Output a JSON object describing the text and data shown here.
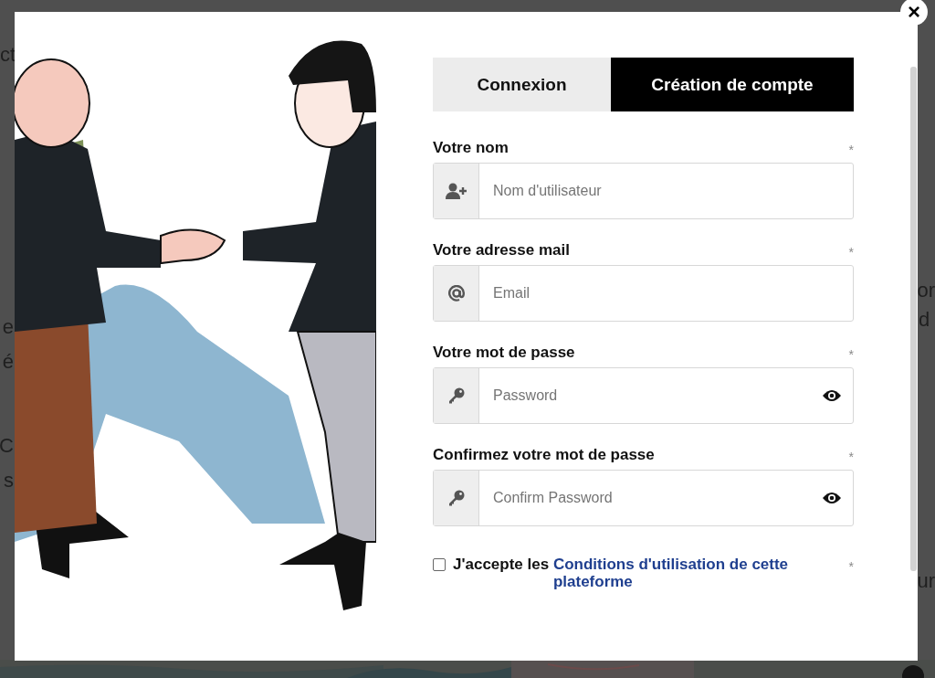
{
  "backdrop": {
    "left_texts": [
      "ct",
      "e",
      "é",
      "C",
      "s"
    ],
    "right_texts": [
      "or",
      "d",
      "ur"
    ],
    "map": {
      "kind": "picture"
    }
  },
  "modal": {
    "close": "×",
    "illustration": {
      "kind": "picture"
    },
    "tabs": [
      {
        "label": "Connexion",
        "selected": false
      },
      {
        "label": "Création de compte",
        "selected": true
      }
    ],
    "fields": [
      {
        "label": "Votre nom",
        "required": "*",
        "kind": "name",
        "placeholder": "Nom d'utilisateur"
      },
      {
        "label": "Votre adresse mail",
        "required": "*",
        "kind": "email",
        "placeholder": "Email"
      },
      {
        "label": "Votre mot de passe",
        "required": "*",
        "kind": "password",
        "placeholder": "Password"
      },
      {
        "label": "Confirmez votre mot de passe",
        "required": "*",
        "kind": "password",
        "placeholder": "Confirm Password"
      }
    ],
    "terms": {
      "checked": false,
      "text": "J'accepte les ",
      "link": "Conditions d'utilisation de cette plateforme",
      "required": "*"
    }
  }
}
